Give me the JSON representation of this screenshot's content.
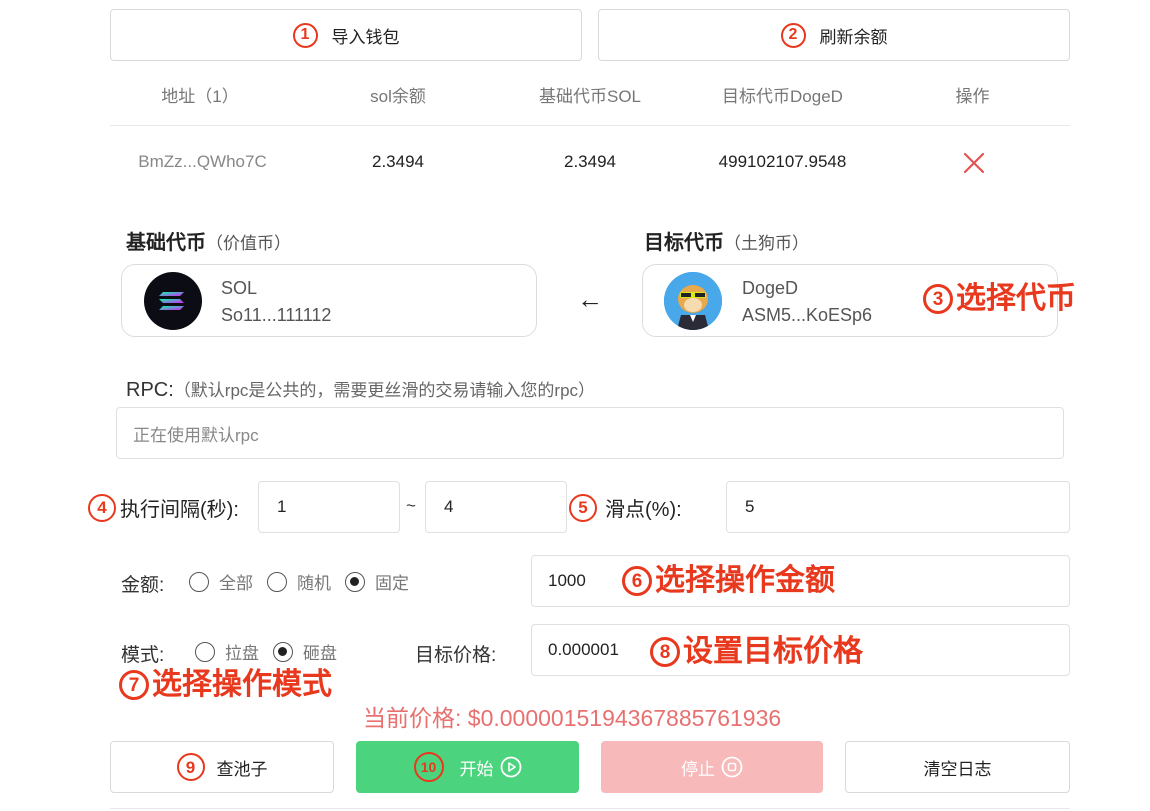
{
  "top_buttons": {
    "import": {
      "num": "1",
      "label": "导入钱包"
    },
    "refresh": {
      "num": "2",
      "label": "刷新余额"
    }
  },
  "table": {
    "headers": [
      "地址（1）",
      "sol余额",
      "基础代币SOL",
      "目标代币DogeD",
      "操作"
    ],
    "row": {
      "address": "BmZz...QWho7C",
      "sol": "2.3494",
      "base": "2.3494",
      "target": "499102107.9548",
      "action_icon": "delete-x-icon"
    }
  },
  "tokens": {
    "base_title": "基础代币",
    "base_sub": "（价值币）",
    "target_title": "目标代币",
    "target_sub": "（土狗币）",
    "base": {
      "name": "SOL",
      "addr": "So11...111112"
    },
    "target": {
      "name": "DogeD",
      "addr": "ASM5...KoESp6"
    },
    "arrow": "←",
    "annotation_num": "3",
    "annotation_text": "选择代币"
  },
  "rpc": {
    "label": "RPC:",
    "hint": "（默认rpc是公共的，需要更丝滑的交易请输入您的rpc）",
    "placeholder": "正在使用默认rpc"
  },
  "interval": {
    "num": "4",
    "label": "执行间隔(秒):",
    "min": "1",
    "sep": "~",
    "max": "4"
  },
  "slippage": {
    "num": "5",
    "label": "滑点(%):",
    "value": "5"
  },
  "amount": {
    "label": "金额:",
    "options": [
      "全部",
      "随机",
      "固定"
    ],
    "selected": "固定",
    "value": "1000",
    "annotation_num": "6",
    "annotation_text": "选择操作金额"
  },
  "mode": {
    "label": "模式:",
    "options": [
      "拉盘",
      "砸盘"
    ],
    "selected": "砸盘",
    "annotation_num": "7",
    "annotation_text": "选择操作模式"
  },
  "target_price": {
    "label": "目标价格:",
    "value": "0.000001",
    "annotation_num": "8",
    "annotation_text": "设置目标价格"
  },
  "current_price": "当前价格: $0.0000015194367885761936",
  "bottom_buttons": {
    "pool": {
      "num": "9",
      "label": "查池子"
    },
    "start": {
      "num": "10",
      "label": "开始"
    },
    "stop": {
      "label": "停止"
    },
    "clear": {
      "label": "清空日志"
    }
  },
  "colors": {
    "annotation": "#e8391e",
    "start_green": "#4cd37e",
    "stop_pink": "#f7b9b9",
    "delete_red": "#e25454",
    "price_red": "#e87070"
  }
}
